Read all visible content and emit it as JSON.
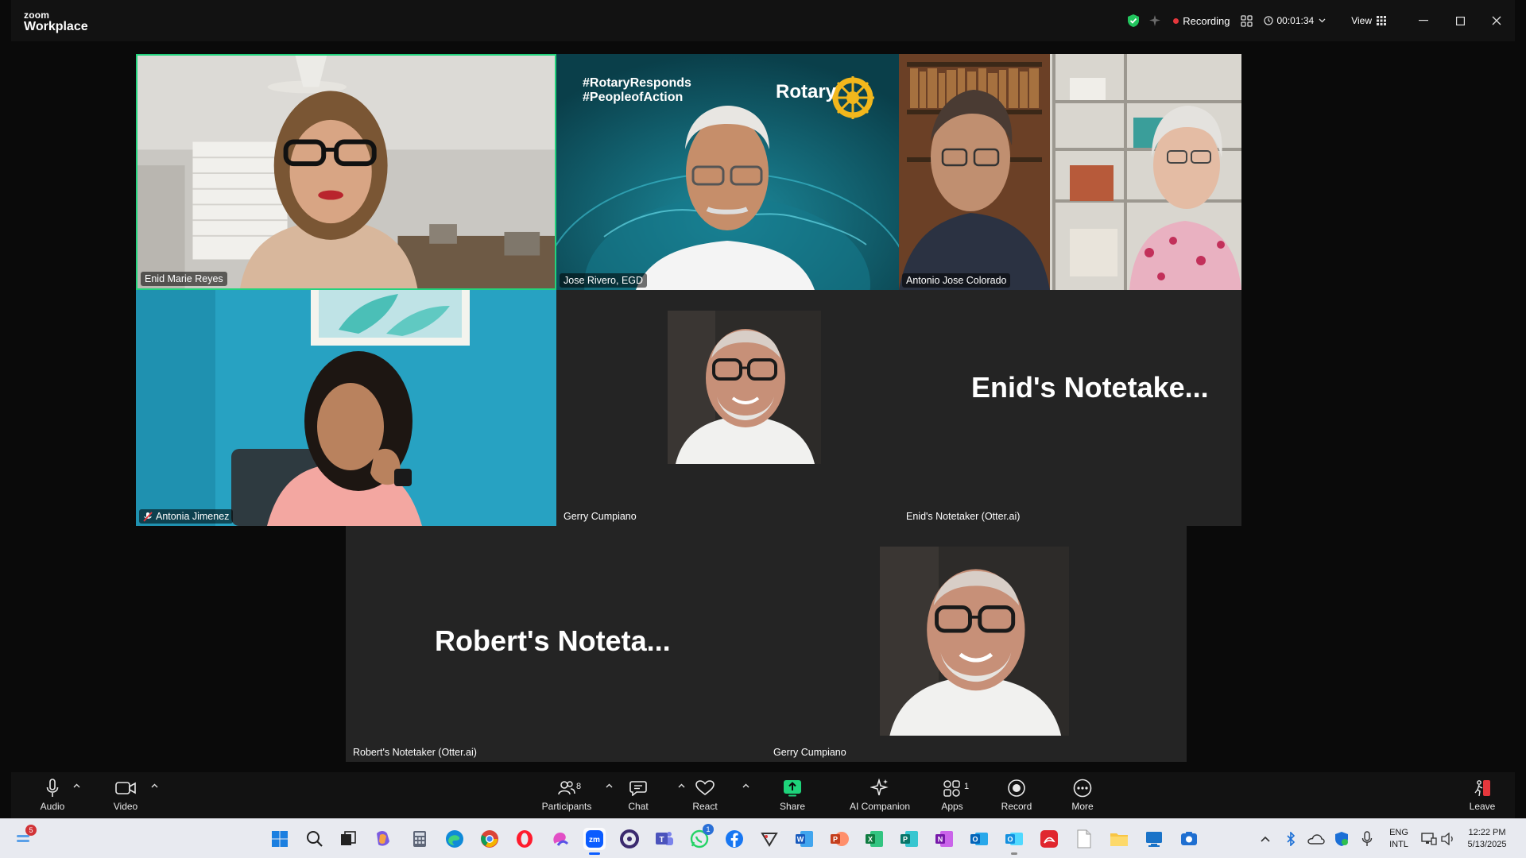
{
  "app": {
    "brand_small": "zoom",
    "brand_large": "Workplace"
  },
  "titlebar": {
    "recording_label": "Recording",
    "timer": "00:01:34",
    "view_label": "View"
  },
  "participants": [
    {
      "name": "Enid Marie Reyes",
      "active_speaker": true
    },
    {
      "name": "Jose Rivero, EGD"
    },
    {
      "name": "Antonio Jose Colorado"
    },
    {
      "name": "Antonia Jimenez",
      "muted": true
    },
    {
      "name": "Gerry Cumpiano"
    },
    {
      "name": "Enid's Notetaker (Otter.ai)",
      "placeholder": "Enid's  Notetake..."
    },
    {
      "name": "Robert's Notetaker (Otter.ai)",
      "placeholder": "Robert's  Noteta..."
    },
    {
      "name": "Gerry Cumpiano"
    }
  ],
  "background_text": {
    "tag1": "#RotaryResponds",
    "tag2": "#PeopleofAction",
    "logo": "Rotary"
  },
  "toolbar": {
    "audio": "Audio",
    "video": "Video",
    "participants": "Participants",
    "participants_count": "8",
    "chat": "Chat",
    "react": "React",
    "share": "Share",
    "ai_companion": "AI Companion",
    "apps": "Apps",
    "apps_count": "1",
    "record": "Record",
    "more": "More",
    "leave": "Leave"
  },
  "taskbar": {
    "notification_badge": "5",
    "whatsapp_badge": "1",
    "lang_top": "ENG",
    "lang_bottom": "INTL",
    "time": "12:22 PM",
    "date": "5/13/2025"
  },
  "colors": {
    "active_speaker": "#22d27d",
    "record_dot": "#e5373c",
    "share_green": "#1ed37a",
    "rotary_gold": "#f2b71c"
  }
}
